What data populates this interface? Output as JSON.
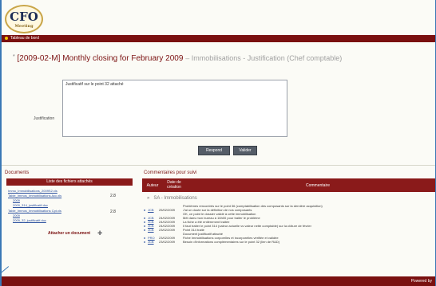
{
  "header": {
    "logo_text": "CFO",
    "logo_tag": "Meeting"
  },
  "nav": {
    "label": "Tableau de bord"
  },
  "task": {
    "title": "[2009-02-M] Monthly closing for February 2009",
    "subtitle": "– Immobilisations - Justification (Chef comptable)"
  },
  "form": {
    "justification_label": "Justification",
    "justification_value": "Justificatif sur le point 32 attaché",
    "btn_respond": "Respond",
    "btn_validate": "Valider"
  },
  "documents": {
    "title": "Documents",
    "header": "Liste des fichiers attachés",
    "rows": [
      {
        "name": "Immo_Immobilisations_2009S2.xls",
        "size": ""
      },
      {
        "name": "Table_Immos_Immobilisations Acc.xls",
        "size": "2.8"
      },
      {
        "name": "2009",
        "size": ""
      },
      {
        "name": "2009_314_justificatif.doc",
        "size": ""
      },
      {
        "name": "Table_Immos_Immobilisations Cpt.xls",
        "size": "2.8"
      },
      {
        "name": "2009",
        "size": ""
      },
      {
        "name": "2009_32_justificatif.doc",
        "size": ""
      }
    ],
    "attach_label": "Attacher un document",
    "attach_icon": "paperclip-icon"
  },
  "comments": {
    "title": "Commentaires pour suivi",
    "col_author": "Auteur",
    "col_date": "Date de création",
    "col_comment": "Commentaire",
    "group": "SA - Immobilisations",
    "rows": [
      {
        "author": "",
        "date": "",
        "text": "Problèmes rencontrés sur le point 36 (comptabilisation des composants sur la dernière acquisition)"
      },
      {
        "author": "JCB",
        "date": "25/02/2009",
        "text": "J'ai un doute sur la définition de nos composants"
      },
      {
        "author": "",
        "date": "",
        "text": "OK, ce point le dossier validé à cette immobilisation"
      },
      {
        "author": "JCB",
        "date": "24/02/2009",
        "text": "Mèl dans mon bureau à 16h00 pour traiter le problème"
      },
      {
        "author": "JCB",
        "date": "24/02/2009",
        "text": "La fiche a été entièrement traitée"
      },
      {
        "author": "JCB",
        "date": "24/02/2009",
        "text": "Il faut traiter le point 314 (valeur actuelle vs valeur nette comptable) sur la clôture de février"
      },
      {
        "author": "JCB",
        "date": "23/02/2009",
        "text": "Point 314 traité"
      },
      {
        "author": "",
        "date": "",
        "text": "Document justificatif attaché"
      },
      {
        "author": "PRO",
        "date": "23/02/2009",
        "text": "Fiche Immobilisations corporelles et incorporelles vérifiée et validée"
      },
      {
        "author": "JCB",
        "date": "23/02/2009",
        "text": "Besoin d'informations complémentaires sur le point 32 (lien de R&D)"
      }
    ]
  },
  "footer": {
    "label": "Powered by"
  }
}
